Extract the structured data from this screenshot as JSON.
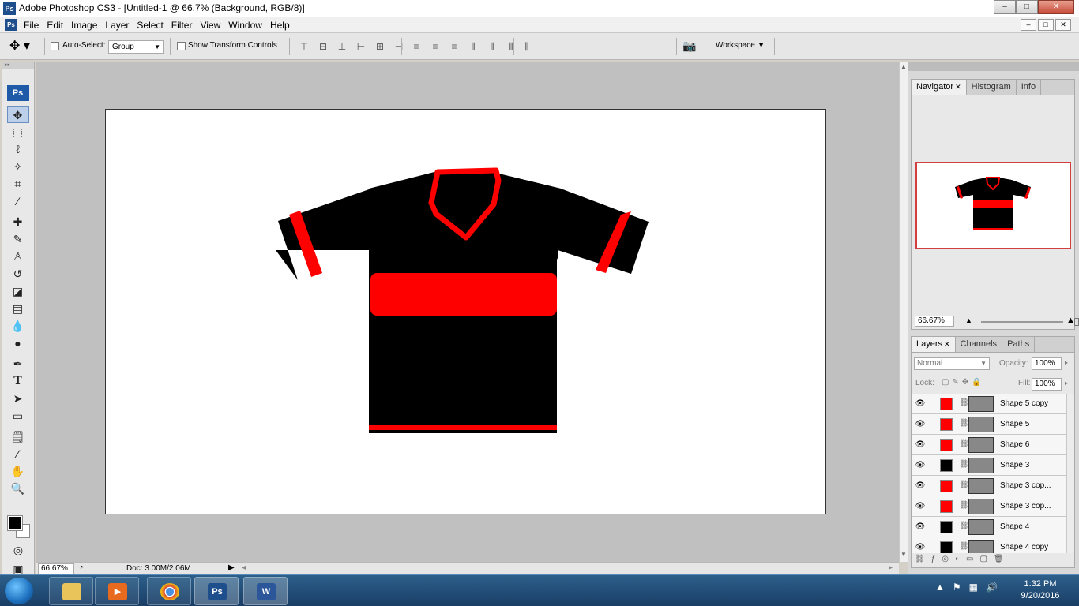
{
  "app": {
    "title": "Adobe Photoshop CS3 - [Untitled-1 @ 66.7% (Background, RGB/8)]",
    "logo_text": "Ps"
  },
  "window_controls": {
    "minimize": "–",
    "maximize": "□",
    "close": "✕"
  },
  "menu": [
    "File",
    "Edit",
    "Image",
    "Layer",
    "Select",
    "Filter",
    "View",
    "Window",
    "Help"
  ],
  "options": {
    "auto_select_label": "Auto-Select:",
    "auto_select_value": "Group",
    "show_transform_label": "Show Transform Controls",
    "workspace_label": "Workspace ▼"
  },
  "status": {
    "zoom": "66.67%",
    "doc": "Doc: 3.00M/2.06M"
  },
  "navigator": {
    "tabs": [
      "Navigator",
      "Histogram",
      "Info"
    ],
    "zoom": "66.67%"
  },
  "layers_panel": {
    "tabs": [
      "Layers",
      "Channels",
      "Paths"
    ],
    "blend_mode": "Normal",
    "opacity_label": "Opacity:",
    "opacity": "100%",
    "lock_label": "Lock:",
    "fill_label": "Fill:",
    "fill": "100%",
    "layers": [
      {
        "name": "Shape 5 copy",
        "color": "#ff0000"
      },
      {
        "name": "Shape 5",
        "color": "#ff0000"
      },
      {
        "name": "Shape 6",
        "color": "#ff0000"
      },
      {
        "name": "Shape 3",
        "color": "#000000"
      },
      {
        "name": "Shape 3 cop...",
        "color": "#ff0000"
      },
      {
        "name": "Shape 3 cop...",
        "color": "#ff0000"
      },
      {
        "name": "Shape 4",
        "color": "#000000"
      },
      {
        "name": "Shape 4 copy",
        "color": "#000000"
      }
    ]
  },
  "taskbar": {
    "time": "1:32 PM",
    "date": "9/20/2016",
    "apps": [
      "file-explorer",
      "media-player",
      "chrome",
      "photoshop",
      "word"
    ]
  },
  "colors": {
    "shirt_body": "#000000",
    "shirt_accent": "#ff0000",
    "foreground": "#000000",
    "background": "#ffffff"
  }
}
